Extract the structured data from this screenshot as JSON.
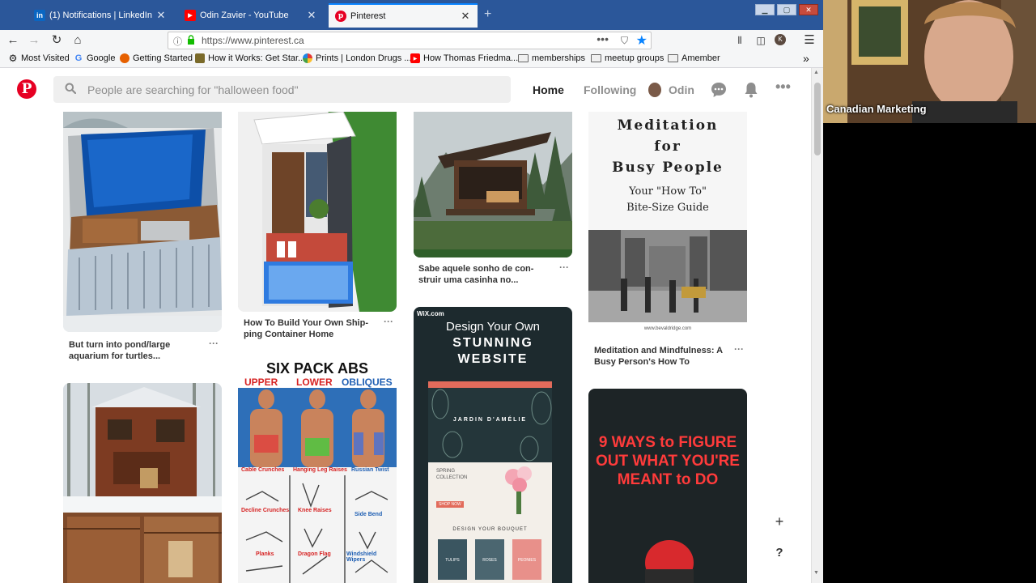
{
  "tabs": [
    {
      "title": "(1) Notifications | LinkedIn",
      "favicon": "linkedin-icon"
    },
    {
      "title": "Odin Zavier - YouTube",
      "favicon": "youtube-icon"
    },
    {
      "title": "Pinterest",
      "favicon": "pinterest-icon",
      "active": true
    }
  ],
  "address": {
    "url": "https://www.pinterest.ca"
  },
  "bookmarks": [
    "Most Visited",
    "Google",
    "Getting Started",
    "How it Works: Get Star...",
    "Prints | London Drugs ...",
    "How Thomas Friedma...",
    "memberships",
    "meetup groups",
    "Amember"
  ],
  "pinterest": {
    "search_placeholder": "People are searching for \"halloween food\"",
    "nav": {
      "home": "Home",
      "following": "Following",
      "user": "Odin"
    },
    "brand_color": "#e60023"
  },
  "pins": {
    "pool_caption": "But turn into pond/large aquarium for turtles...",
    "container_caption": "How To Build Your Own Ship- ping Container Home",
    "cabin_caption": "Sabe aquele sonho de con- struir uma casinha no...",
    "meditation": {
      "line1": "Meditation",
      "line2": "for",
      "line3": "Busy People",
      "line4": "Your \"How To\"",
      "line5": "Bite-Size Guide",
      "url": "www.bevaldridge.com",
      "caption": "Meditation and Mindfulness: A Busy Person's How To"
    },
    "abs": {
      "title": "SIX PACK ABS",
      "upper": "UPPER",
      "lower": "LOWER",
      "obliques": "OBLIQUES",
      "ex1": "Cable Crunches",
      "ex2": "Hanging Leg Raises",
      "ex3": "Russian Twist",
      "ex4": "Decline Crunches",
      "ex5": "Knee Raises",
      "ex6": "Side Bend",
      "ex7": "Planks",
      "ex8": "Dragon Flag",
      "ex9": "Windshield Wipers"
    },
    "wix": {
      "brand": "WiX.com",
      "line1": "Design Your Own",
      "line2": "STUNNING",
      "line3": "WEBSITE",
      "site": "JARDIN D'AMÉLIE",
      "collection1": "SPRING",
      "collection2": "COLLECTION",
      "shop": "SHOP NOW",
      "bouquet": "DESIGN YOUR BOUQUET",
      "flower1": "TULIPS",
      "flower2": "ROSES",
      "flower3": "PEONIES"
    },
    "ways": {
      "line1": "9 WAYS to FIGURE",
      "line2": "OUT WHAT YOU'RE",
      "line3": "MEANT to DO"
    }
  },
  "fab": {
    "plus": "+",
    "help": "?"
  },
  "webcam": {
    "label": "Canadian Marketing"
  }
}
